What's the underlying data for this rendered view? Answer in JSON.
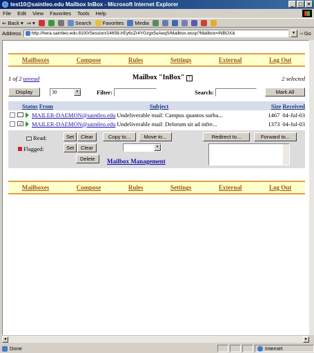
{
  "window": {
    "title": "test10@saintleo.edu Mailbox InBox - Microsoft Internet Explorer",
    "min": "_",
    "max": "□",
    "close": "×"
  },
  "menu": [
    "File",
    "Edit",
    "View",
    "Favorites",
    "Tools",
    "Help"
  ],
  "toolbar": {
    "back": "Back",
    "back_arrow": "⇐",
    "forward": "⇒",
    "dropdown_caret": "▾",
    "search": "Search",
    "favorites": "Favorites",
    "media": "Media"
  },
  "address": {
    "label": "Address",
    "url": "http://hera.saintleo.edu:8100/Session/14658-lrEy6cZr4YGzgx5uAeqS/Mailbox.wssp?Mailbox=INBOX&",
    "go": "Go",
    "go_arrow": "⇒"
  },
  "nav": [
    "Mailboxes",
    "Compose",
    "Rules",
    "Settings",
    "External",
    "Log Out"
  ],
  "mailbox": {
    "page_prefix": "1 of 2",
    "page_link": "unread",
    "title": "Mailbox \"InBox\"",
    "help": "?",
    "selected": "2 selected"
  },
  "controls": {
    "display": "Display",
    "count": "30",
    "filter_label": "Filter:",
    "search_label": "Search:",
    "mark_all": "Mark All"
  },
  "columns": {
    "status": "Status",
    "from": "From",
    "subject": "Subject",
    "size": "Size",
    "received": "Received"
  },
  "messages": [
    {
      "from": "MAILER-DAEMON@saintleo.edu",
      "subject": "Undeliverable mail: Campus quantos surba...",
      "size": "1467",
      "received": "04-Jul-03"
    },
    {
      "from": "MAILER-DAEMON@saintleo.edu",
      "subject": "Undeliverable mail: Delorum sit ad infre...",
      "size": "1373",
      "received": "04-Jul-03"
    }
  ],
  "actions": {
    "read_label": "Read:",
    "flagged_label": "Flagged:",
    "set": "Set",
    "clear": "Clear",
    "delete": "Delete",
    "copy_to": "Copy to...",
    "move_to": "Move to...",
    "mailbox_management": "Mailbox Management",
    "redirect_to": "Redirect to...",
    "forward_to": "Forward to..."
  },
  "status": {
    "text": "Done",
    "zone": "Internet"
  },
  "scroll_arrows": {
    "left": "◂",
    "right": "▸"
  }
}
